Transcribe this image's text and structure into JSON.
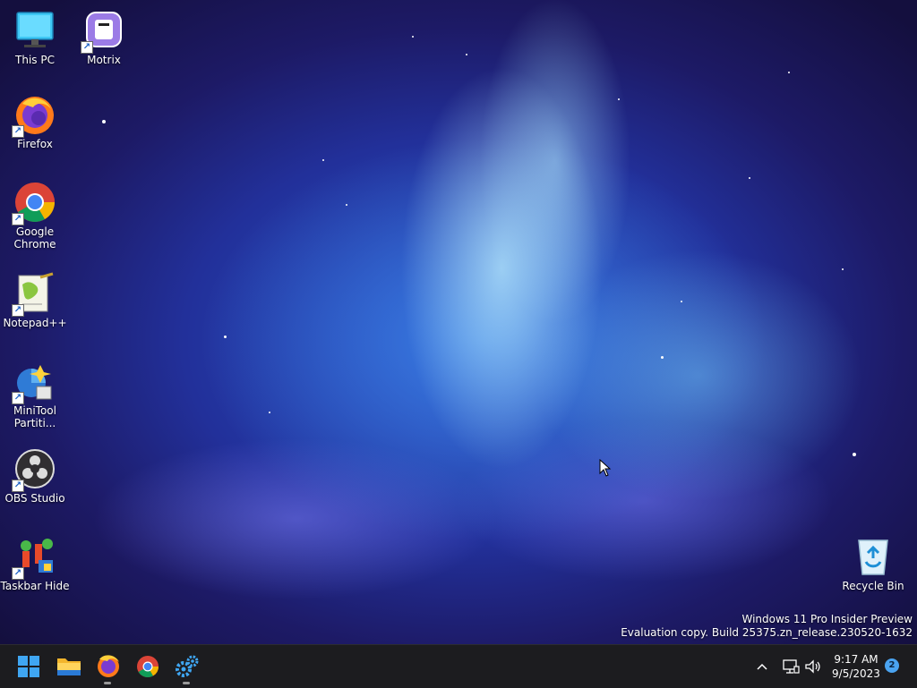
{
  "desktop": {
    "icons": [
      {
        "label": "This PC",
        "icon": "computer-icon",
        "shortcut": false
      },
      {
        "label": "Motrix",
        "icon": "motrix-icon",
        "shortcut": true
      },
      {
        "label": "Firefox",
        "icon": "firefox-icon",
        "shortcut": true
      },
      {
        "label": "Google Chrome",
        "icon": "chrome-icon",
        "shortcut": true
      },
      {
        "label": "Notepad++",
        "icon": "notepadplusplus-icon",
        "shortcut": true
      },
      {
        "label": "MiniTool Partiti...",
        "icon": "minitool-icon",
        "shortcut": true
      },
      {
        "label": "OBS Studio",
        "icon": "obs-icon",
        "shortcut": true
      },
      {
        "label": "Taskbar Hide",
        "icon": "taskbar-hide-icon",
        "shortcut": true
      },
      {
        "label": "Recycle Bin",
        "icon": "recycle-bin-icon",
        "shortcut": false
      }
    ],
    "shortcut_arrow": "↗",
    "watermark": {
      "line1": "Windows 11 Pro Insider Preview",
      "line2": "Evaluation copy. Build 25375.zn_release.230520-1632"
    }
  },
  "taskbar": {
    "pinned": [
      {
        "name": "Start",
        "icon": "windows-start-icon",
        "running": false
      },
      {
        "name": "File Explorer",
        "icon": "folder-icon",
        "running": false
      },
      {
        "name": "Firefox",
        "icon": "firefox-icon",
        "running": true
      },
      {
        "name": "Google Chrome",
        "icon": "chrome-icon",
        "running": false
      },
      {
        "name": "Settings",
        "icon": "gears-icon",
        "running": true
      }
    ],
    "tray": {
      "overflow_icon": "chevron-up-icon",
      "network_icon": "network-icon",
      "volume_icon": "speaker-icon",
      "time": "9:17 AM",
      "date": "9/5/2023",
      "notification_count": "2"
    }
  },
  "colors": {
    "taskbar_bg": "#1c1c1f",
    "accent": "#4aa3f0"
  }
}
